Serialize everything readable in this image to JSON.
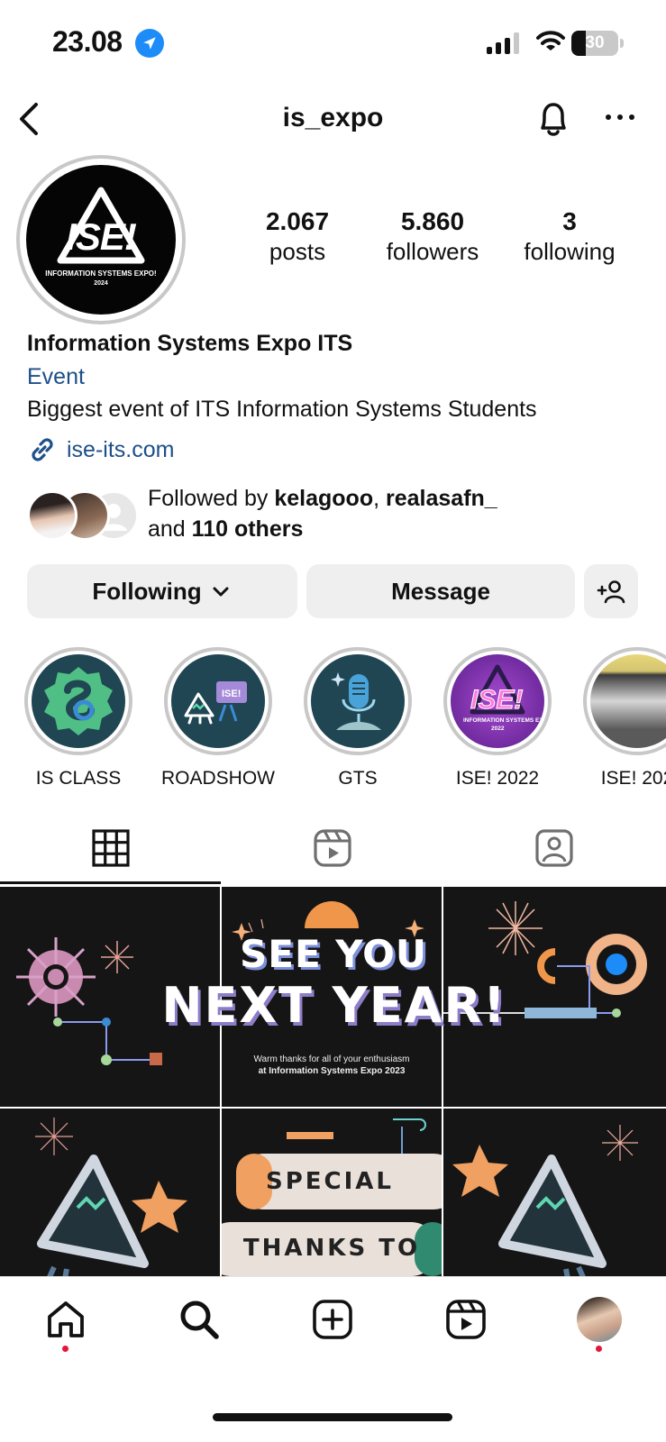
{
  "status_bar": {
    "time": "23.08",
    "battery": "30",
    "battery_level": 0.3
  },
  "header": {
    "username": "is_expo"
  },
  "profile": {
    "avatar_text": "ISE!",
    "avatar_sub": "INFORMATION SYSTEMS EXPO!",
    "avatar_year": "2024",
    "stats": [
      {
        "value": "2.067",
        "label": "posts"
      },
      {
        "value": "5.860",
        "label": "followers"
      },
      {
        "value": "3",
        "label": "following"
      }
    ],
    "name": "Information Systems Expo ITS",
    "category": "Event",
    "bio": "Biggest event of ITS Information Systems Students",
    "link": "ise-its.com",
    "followed_by": {
      "prefix": "Followed by",
      "user1": "kelagooo",
      "separator": ",",
      "user2": "realasafn_",
      "and": "and",
      "others": "110 others"
    }
  },
  "buttons": {
    "following": "Following",
    "message": "Message"
  },
  "highlights": [
    {
      "label": "IS CLASS"
    },
    {
      "label": "ROADSHOW"
    },
    {
      "label": "GTS"
    },
    {
      "label": "ISE! 2022"
    },
    {
      "label": "ISE! 202"
    }
  ],
  "posts": {
    "banner_line1": "SEE YOU",
    "banner_line2": "NEXT YEAR!",
    "banner_caption1": "Warm thanks for all of your enthusiasm",
    "banner_caption2": "at Information Systems Expo 2023",
    "special": "SPECIAL",
    "thanks": "THANKS TO"
  },
  "colors": {
    "link_blue": "#1d4f8a",
    "location_blue": "#1d8cf8",
    "notification_red": "#e5163d",
    "button_bg": "#efefef"
  }
}
